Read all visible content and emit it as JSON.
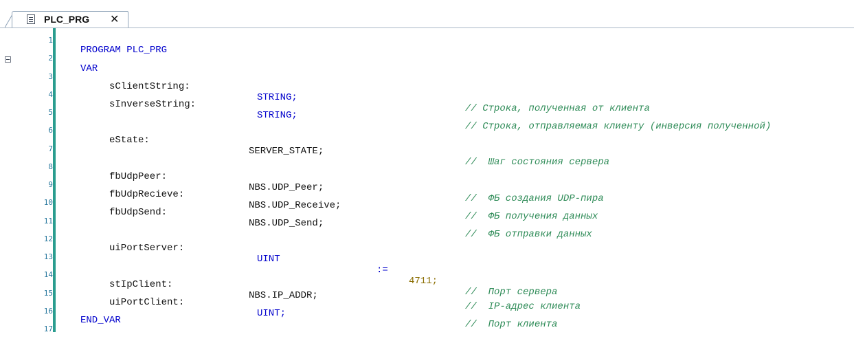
{
  "tab": {
    "title": "PLC_PRG",
    "close": "✕"
  },
  "lines": [
    {
      "n": "1"
    },
    {
      "n": "2"
    },
    {
      "n": "3"
    },
    {
      "n": "4"
    },
    {
      "n": "5"
    },
    {
      "n": "6"
    },
    {
      "n": "7"
    },
    {
      "n": "8"
    },
    {
      "n": "9"
    },
    {
      "n": "10"
    },
    {
      "n": "11"
    },
    {
      "n": "12"
    },
    {
      "n": "13"
    },
    {
      "n": "14"
    },
    {
      "n": "15"
    },
    {
      "n": "16"
    },
    {
      "n": "17"
    }
  ],
  "code": {
    "l1": "PROGRAM PLC_PRG",
    "l2": "VAR",
    "l3_name": "sClientString:",
    "l3_type": "STRING;",
    "l3_comment": "// Строка, полученная от клиента",
    "l4_name": "sInverseString:",
    "l4_type": "STRING;",
    "l4_comment": "// Строка, отправляемая клиенту (инверсия полученной)",
    "l6_name": "eState:",
    "l6_type": "SERVER_STATE;",
    "l6_comment": "//  Шаг состояния сервера",
    "l8_name": "fbUdpPeer:",
    "l8_type": "NBS.UDP_Peer;",
    "l8_comment": "//  ФБ создания UDP-пира",
    "l9_name": "fbUdpRecieve:",
    "l9_type": "NBS.UDP_Receive;",
    "l9_comment": "//  ФБ получения данных",
    "l10_name": "fbUdpSend:",
    "l10_type": "NBS.UDP_Send;",
    "l10_comment": "//  ФБ отправки данных",
    "l12_name": "uiPortServer:",
    "l12_type": "UINT",
    "l12_assign": ":=",
    "l12_value": "4711;",
    "l12_comment": "//  Порт сервера",
    "l14_name": "stIpClient:",
    "l14_type": "NBS.IP_ADDR;",
    "l14_comment": "//  IP-адрес клиента",
    "l15_name": "uiPortClient:",
    "l15_type": "UINT;",
    "l15_comment": "//  Порт клиента",
    "l16": "END_VAR"
  },
  "colors": {
    "keyword": "#0000cc",
    "comment": "#2e8b57",
    "number": "#8a6d00",
    "gutter_bar": "#2a9d8f",
    "line_number": "#2b7a9f"
  }
}
